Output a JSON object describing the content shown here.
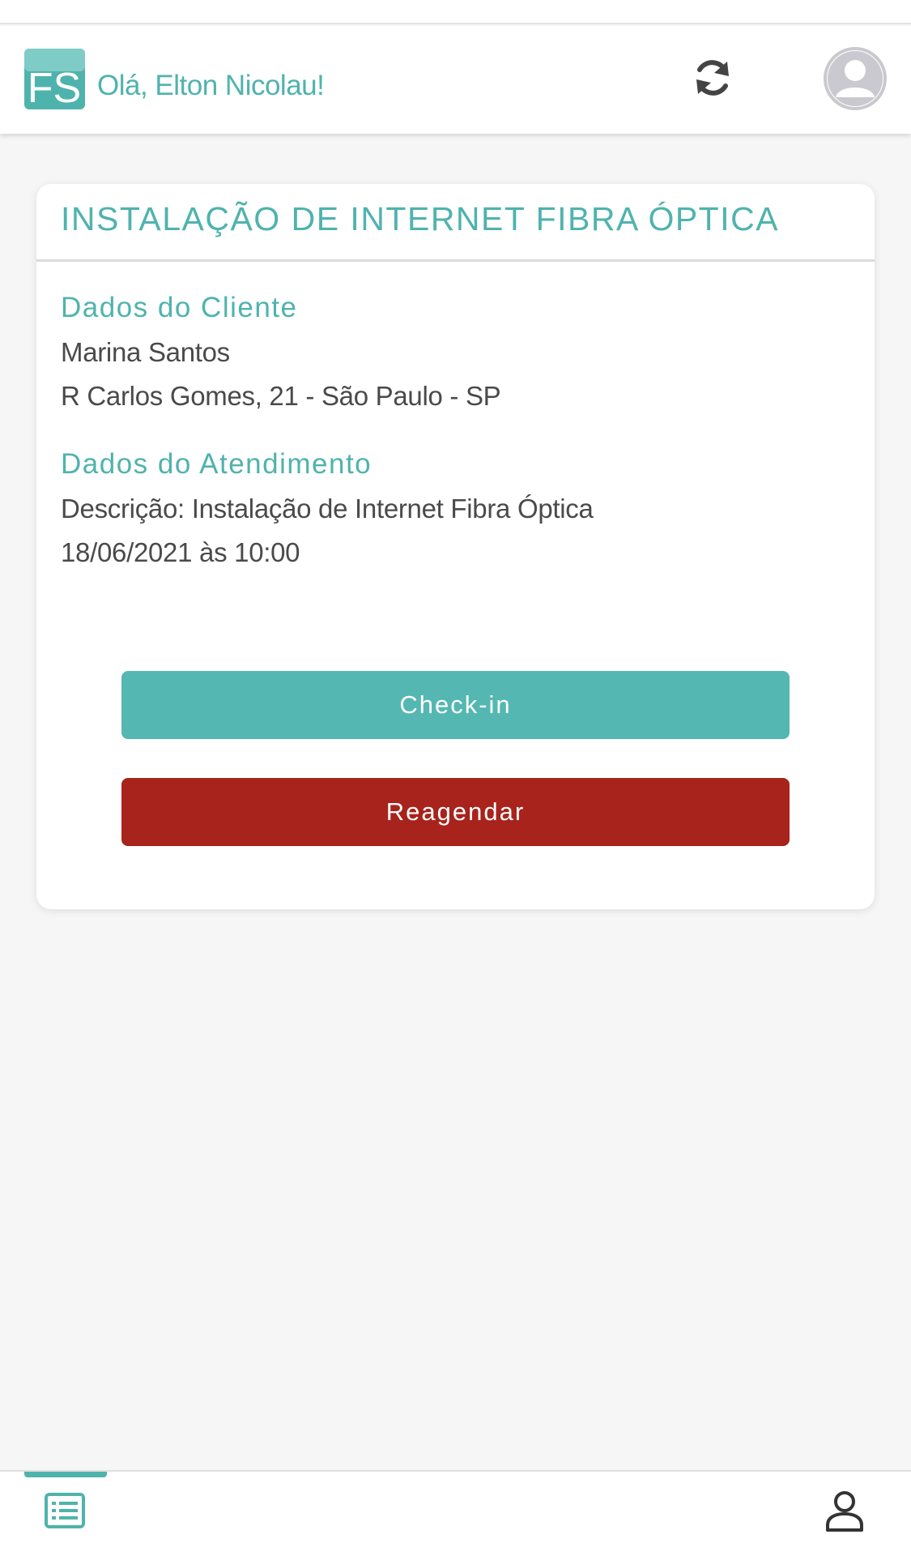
{
  "header": {
    "logo_text": "FS",
    "greeting": "Olá, Elton Nicolau!",
    "refresh_icon": "refresh-icon",
    "avatar_icon": "user-avatar-icon"
  },
  "card": {
    "title": "INSTALAÇÃO DE INTERNET FIBRA ÓPTICA",
    "client_section": {
      "heading": "Dados do Cliente",
      "name": "Marina Santos",
      "address": "R Carlos Gomes, 21 - São Paulo - SP"
    },
    "service_section": {
      "heading": "Dados do Atendimento",
      "description": "Descrição: Instalação de Internet Fibra Óptica",
      "datetime": "18/06/2021 às 10:00"
    },
    "buttons": {
      "checkin": "Check-in",
      "reschedule": "Reagendar"
    }
  },
  "bottom_nav": {
    "tabs": [
      {
        "icon": "list-icon",
        "active": true
      },
      {
        "icon": "profile-icon",
        "active": false
      }
    ]
  },
  "colors": {
    "accent": "#4fb3ad",
    "checkin_button": "#55b7b2",
    "reschedule_button": "#a8231c",
    "background": "#f6f6f6"
  }
}
